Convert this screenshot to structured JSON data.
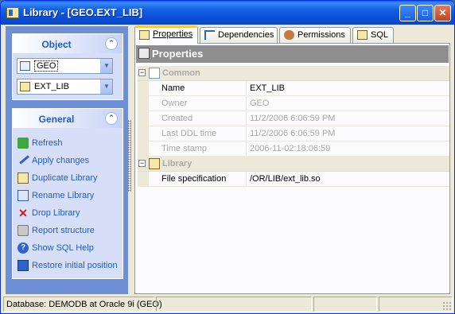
{
  "window": {
    "title": "Library - [GEO.EXT_LIB]"
  },
  "object_panel": {
    "header": "Object",
    "database_combo": "GEO",
    "library_combo": "EXT_LIB"
  },
  "general_panel": {
    "header": "General",
    "items": [
      {
        "label": "Refresh",
        "icon": "refresh-icon"
      },
      {
        "label": "Apply changes",
        "icon": "apply-icon"
      },
      {
        "label": "Duplicate Library",
        "icon": "duplicate-icon"
      },
      {
        "label": "Rename Library",
        "icon": "rename-icon"
      },
      {
        "label": "Drop Library",
        "icon": "drop-icon"
      },
      {
        "label": "Report structure",
        "icon": "report-icon"
      },
      {
        "label": "Show SQL Help",
        "icon": "help-icon"
      },
      {
        "label": "Restore initial position",
        "icon": "restore-icon"
      }
    ]
  },
  "tabs": [
    {
      "label": "Properties",
      "active": true
    },
    {
      "label": "Dependencies",
      "active": false
    },
    {
      "label": "Permissions",
      "active": false
    },
    {
      "label": "SQL",
      "active": false
    }
  ],
  "properties": {
    "header": "Properties",
    "common_category": "Common",
    "rows_common": [
      {
        "name": "Name",
        "value": "EXT_LIB",
        "readonly": false
      },
      {
        "name": "Owner",
        "value": "GEO",
        "readonly": true
      },
      {
        "name": "Created",
        "value": "11/2/2006 6:06:59 PM",
        "readonly": true
      },
      {
        "name": "Last DDL time",
        "value": "11/2/2006 6:06:59 PM",
        "readonly": true
      },
      {
        "name": "Time stamp",
        "value": "2006-11-02:18:06:59",
        "readonly": true
      }
    ],
    "library_category": "Library",
    "rows_library": [
      {
        "name": "File specification",
        "value": "/OR/LIB/ext_lib.so",
        "readonly": false
      }
    ]
  },
  "statusbar": {
    "text": "Database: DEMODB  at Oracle 9i (GEO)"
  },
  "colors": {
    "titlebar": "#0a4fd6",
    "panel_bg": "#6d8fd8",
    "link": "#215dc6",
    "active_tab_top": "#ffc83c"
  }
}
